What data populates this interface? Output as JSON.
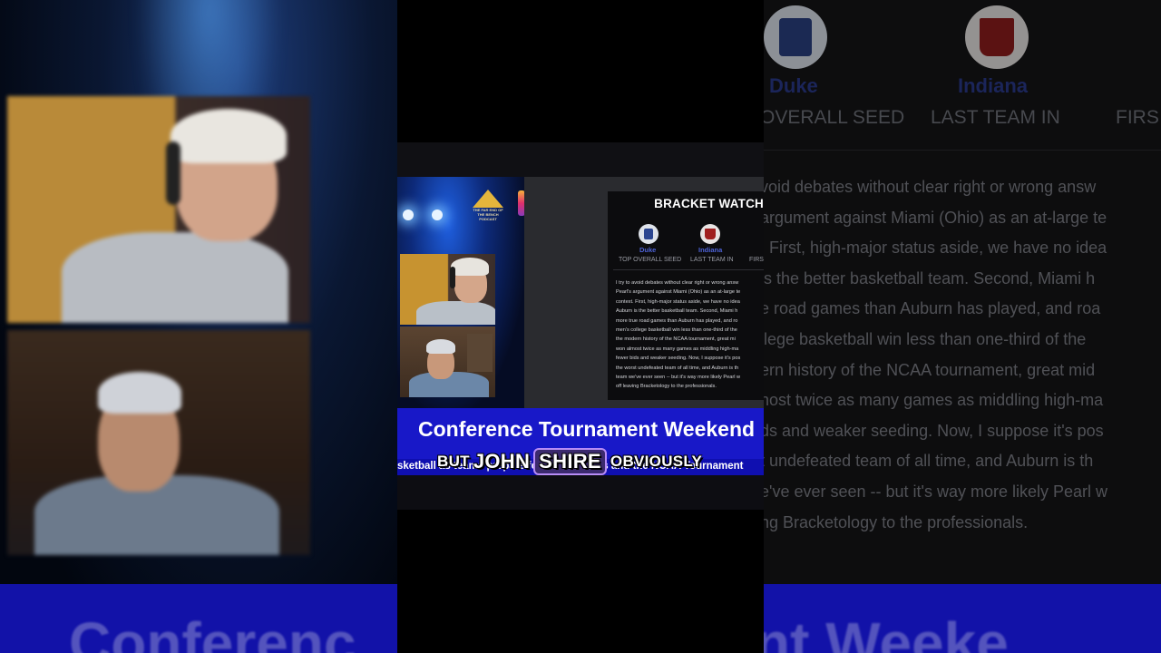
{
  "background_right": {
    "teams": [
      {
        "name": "Duke",
        "sub": "OVERALL SEED"
      },
      {
        "name": "Indiana",
        "sub": "LAST TEAM IN"
      }
    ],
    "extra_sub": "FIRS",
    "paragraph_lines": [
      "void debates without clear right or wrong answ",
      "argument against Miami (Ohio) as an at-large te",
      ". First, high-major status aside, we have no idea",
      "is the better basketball team. Second, Miami h",
      "e road games than Auburn has played, and roa",
      "llege basketball win less than one-third of the",
      "ern history of the NCAA tournament, great mid",
      "nost twice as many games as middling high-ma",
      "ds and weaker seeding. Now, I suppose it's pos",
      "t undefeated team of all time, and Auburn is th",
      "e've ever seen -- but it's way more likely Pearl w",
      "ng Bracketology to the professionals."
    ],
    "band_text": "nt Weeke"
  },
  "background_left": {
    "band_text": "Conferenc"
  },
  "podcast": {
    "logo_text": "THE FAR END OF THE BENCH PODCAST"
  },
  "article": {
    "heading": "BRACKET WATCH",
    "teams": [
      {
        "name": "Duke",
        "sub": "TOP OVERALL SEED"
      },
      {
        "name": "Indiana",
        "sub": "LAST TEAM IN"
      }
    ],
    "extra_sub": "FIRS",
    "lines": [
      "I try to avoid debates without clear right or wrong answ",
      "Pearl's argument against Miami (Ohio) as an at-large te",
      "context. First, high-major status aside, we have no idea",
      "Auburn is the better basketball team. Second, Miami h",
      "more true road games than Auburn has played, and ro",
      "men's college basketball win less than one-third of the",
      "the modern history of the NCAA tournament, great mi",
      "won almost twice as many games as middling high-ma",
      "fewer bids and weaker seeding. Now, I suppose it's pos",
      "the worst undefeated team of all time, and Auburn is th",
      "team we've ever seen -- but it's way more likely Pearl w",
      "off leaving Bracketology to the professionals."
    ]
  },
  "banner": {
    "title": "Conference Tournament Weekend",
    "ticker": "sketball as teams prepare for the madness and the NCAA Tournament"
  },
  "caption": {
    "words": [
      "BUT",
      "JOHN",
      "SHIRE",
      "OBVIOUSLY"
    ],
    "highlighted_index": 2
  },
  "colors": {
    "banner_blue": "#1818c8",
    "caption_highlight": "#b78cf5",
    "duke_blue": "#2b4590",
    "indiana_red": "#a01f1f"
  }
}
